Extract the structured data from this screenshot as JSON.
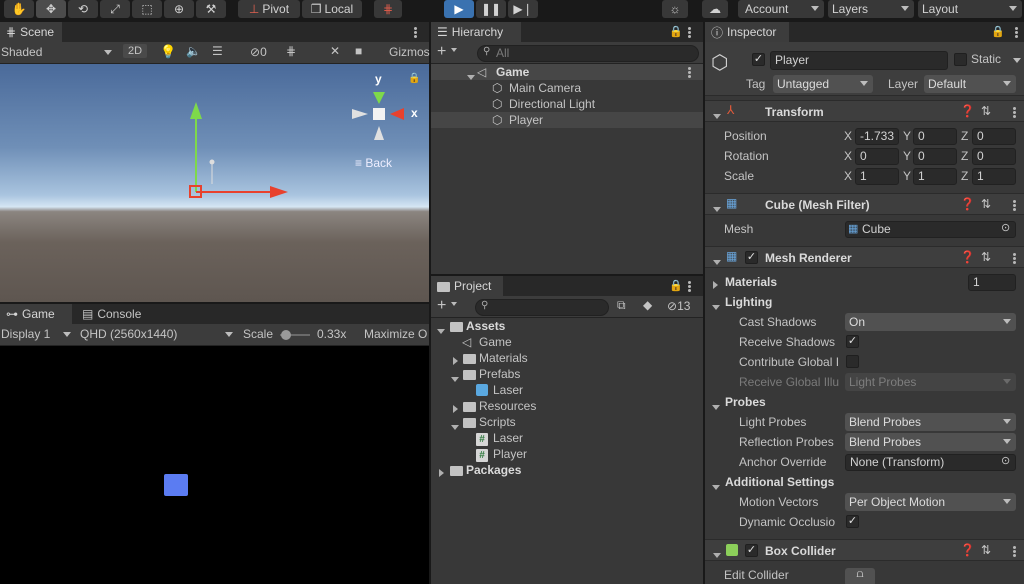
{
  "toolbar": {
    "pivot": "Pivot",
    "local": "Local",
    "account": "Account",
    "layers": "Layers",
    "layout": "Layout"
  },
  "scene": {
    "tab": "Scene",
    "shading": "Shaded",
    "mode2d": "2D",
    "hidden_count": "0",
    "gizmos": "Gizmos",
    "axis_y": "y",
    "axis_x": "x",
    "view_label": "Back"
  },
  "game": {
    "tab": "Game",
    "console_tab": "Console",
    "display": "Display 1",
    "resolution": "QHD (2560x1440)",
    "scale_label": "Scale",
    "scale_value": "0.33x",
    "maximize": "Maximize O"
  },
  "hierarchy": {
    "tab": "Hierarchy",
    "search_placeholder": "All",
    "scene_name": "Game",
    "items": [
      "Main Camera",
      "Directional Light",
      "Player"
    ]
  },
  "project": {
    "tab": "Project",
    "hidden_count": "13",
    "tree": {
      "assets": "Assets",
      "game": "Game",
      "materials": "Materials",
      "prefabs": "Prefabs",
      "laser_prefab": "Laser",
      "resources": "Resources",
      "scripts": "Scripts",
      "laser_script": "Laser",
      "player_script": "Player",
      "packages": "Packages"
    }
  },
  "inspector": {
    "tab": "Inspector",
    "object_name": "Player",
    "static_label": "Static",
    "tag_label": "Tag",
    "tag_value": "Untagged",
    "layer_label": "Layer",
    "layer_value": "Default",
    "transform": {
      "title": "Transform",
      "position_label": "Position",
      "rotation_label": "Rotation",
      "scale_label": "Scale",
      "position": {
        "x": "-1.733",
        "y": "0",
        "z": "0"
      },
      "rotation": {
        "x": "0",
        "y": "0",
        "z": "0"
      },
      "scale": {
        "x": "1",
        "y": "1",
        "z": "1"
      }
    },
    "mesh_filter": {
      "title": "Cube (Mesh Filter)",
      "mesh_label": "Mesh",
      "mesh_value": "Cube"
    },
    "mesh_renderer": {
      "title": "Mesh Renderer",
      "materials_label": "Materials",
      "materials_count": "1",
      "lighting_label": "Lighting",
      "cast_shadows_label": "Cast Shadows",
      "cast_shadows_value": "On",
      "receive_shadows_label": "Receive Shadows",
      "contribute_gi_label": "Contribute Global I",
      "receive_gi_label": "Receive Global Illu",
      "receive_gi_value": "Light Probes",
      "probes_label": "Probes",
      "light_probes_label": "Light Probes",
      "light_probes_value": "Blend Probes",
      "reflection_probes_label": "Reflection Probes",
      "reflection_probes_value": "Blend Probes",
      "anchor_override_label": "Anchor Override",
      "anchor_override_value": "None (Transform)",
      "additional_label": "Additional Settings",
      "motion_vectors_label": "Motion Vectors",
      "motion_vectors_value": "Per Object Motion",
      "dynamic_occlusion_label": "Dynamic Occlusio"
    },
    "box_collider": {
      "title": "Box Collider",
      "edit_collider_label": "Edit Collider"
    }
  },
  "colors": {
    "accent": "#3a72b0",
    "game_cube": "#5b7cf2",
    "axis_x": "#e8412d",
    "axis_y": "#7ed94a",
    "sky_top": "#4a6a9a",
    "ground": "#6b625b"
  }
}
